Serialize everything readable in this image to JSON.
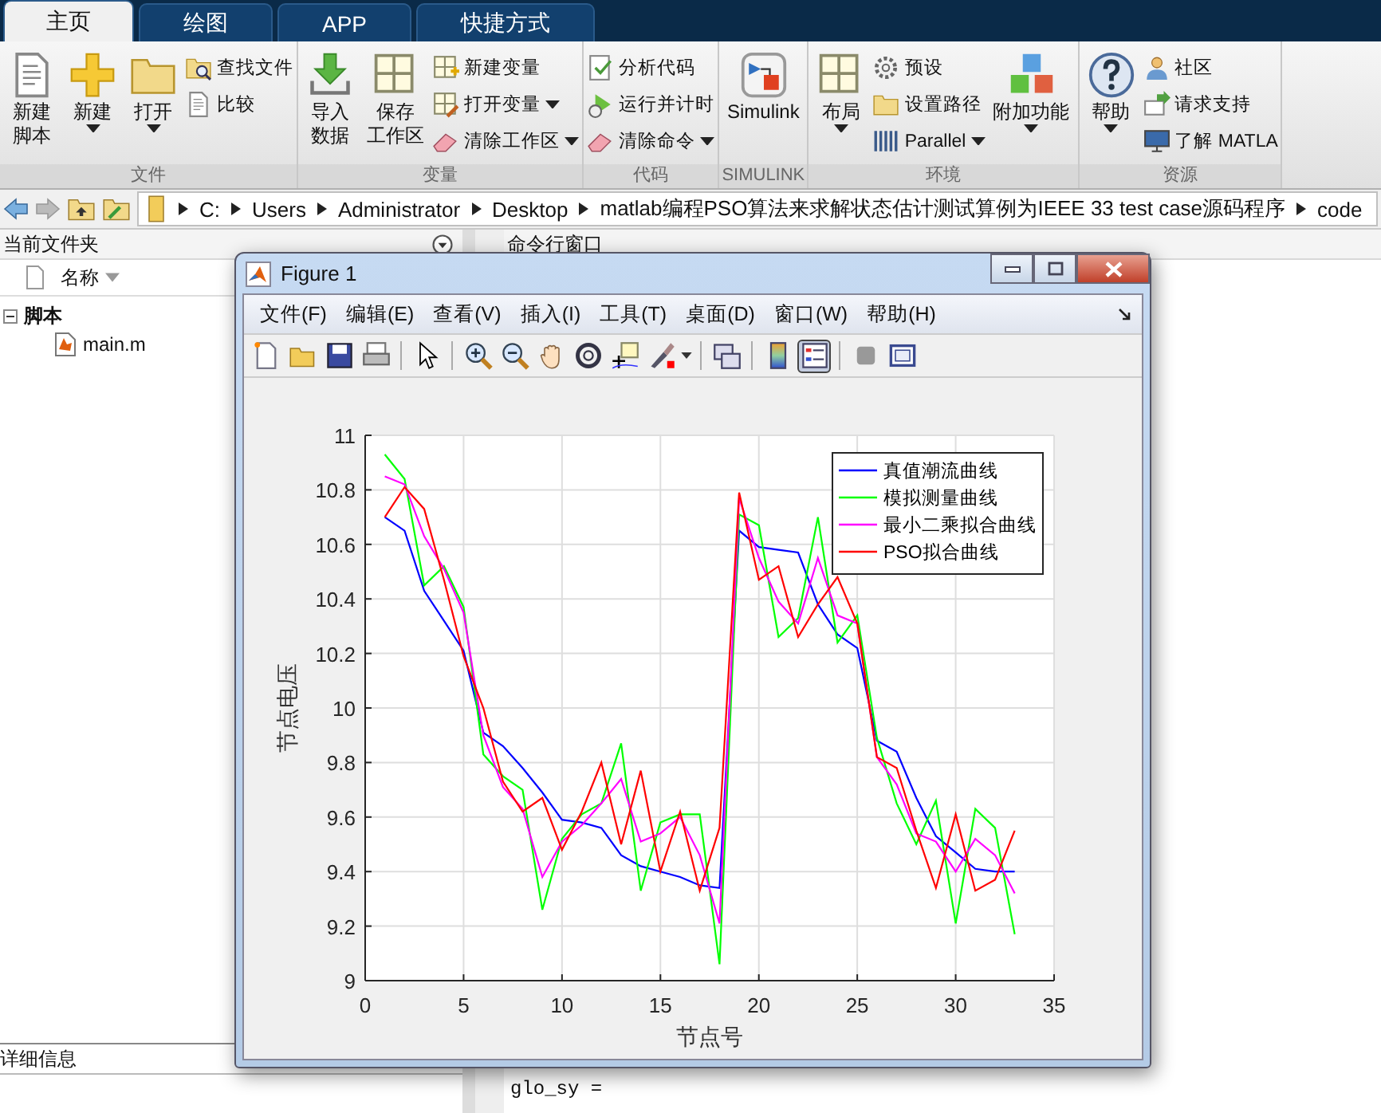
{
  "toolstrip": {
    "tabs": [
      {
        "label": "主页",
        "selected": true
      },
      {
        "label": "绘图",
        "selected": false
      },
      {
        "label": "APP",
        "selected": false
      },
      {
        "label": "快捷方式",
        "selected": false
      }
    ],
    "groups": [
      {
        "title": "文件",
        "items": [
          {
            "kind": "large",
            "lines": [
              "新建",
              "脚本"
            ],
            "dropdown": false
          },
          {
            "kind": "large",
            "lines": [
              "新建"
            ],
            "dropdown": true
          },
          {
            "kind": "large",
            "lines": [
              "打开"
            ],
            "dropdown": true
          },
          {
            "kind": "column",
            "items": [
              {
                "label": "查找文件",
                "dropdown": false
              },
              {
                "label": "比较",
                "dropdown": false
              }
            ]
          }
        ]
      },
      {
        "title": "变量",
        "items": [
          {
            "kind": "large",
            "lines": [
              "导入",
              "数据"
            ],
            "dropdown": false
          },
          {
            "kind": "large",
            "lines": [
              "保存",
              "工作区"
            ],
            "dropdown": false
          },
          {
            "kind": "column",
            "items": [
              {
                "label": "新建变量",
                "dropdown": false
              },
              {
                "label": "打开变量",
                "dropdown": true
              },
              {
                "label": "清除工作区",
                "dropdown": true
              }
            ]
          }
        ]
      },
      {
        "title": "代码",
        "items": [
          {
            "kind": "column",
            "items": [
              {
                "label": "分析代码",
                "dropdown": false
              },
              {
                "label": "运行并计时",
                "dropdown": false
              },
              {
                "label": "清除命令",
                "dropdown": true
              }
            ]
          }
        ]
      },
      {
        "title": "SIMULINK",
        "items": [
          {
            "kind": "large",
            "lines": [
              "Simulink"
            ],
            "dropdown": false
          }
        ]
      },
      {
        "title": "环境",
        "items": [
          {
            "kind": "large",
            "lines": [
              "布局"
            ],
            "dropdown": true
          },
          {
            "kind": "column",
            "items": [
              {
                "label": "预设",
                "dropdown": false
              },
              {
                "label": "设置路径",
                "dropdown": false
              },
              {
                "label": "Parallel",
                "dropdown": true
              }
            ]
          },
          {
            "kind": "large",
            "lines": [
              "附加功能"
            ],
            "dropdown": true
          }
        ]
      },
      {
        "title": "资源",
        "items": [
          {
            "kind": "large",
            "lines": [
              "帮助"
            ],
            "dropdown": true
          },
          {
            "kind": "column",
            "items": [
              {
                "label": "社区",
                "dropdown": false
              },
              {
                "label": "请求支持",
                "dropdown": false
              },
              {
                "label": "了解 MATLA",
                "dropdown": false
              }
            ]
          }
        ]
      }
    ]
  },
  "address_bar": {
    "path": [
      "C:",
      "Users",
      "Administrator",
      "Desktop",
      "matlab编程PSO算法来求解状态估计测试算例为IEEE 33 test case源码程序",
      "code"
    ]
  },
  "current_folder": {
    "title": "当前文件夹",
    "column": "名称",
    "tree": [
      {
        "label": "脚本",
        "expanded": true,
        "children": [
          {
            "label": "main.m"
          }
        ]
      }
    ],
    "details_title": "详细信息"
  },
  "command_window": {
    "title": "命令行窗口",
    "lines": [
      "glo_sy ="
    ]
  },
  "figure": {
    "title": "Figure 1",
    "menu": [
      "文件(F)",
      "编辑(E)",
      "查看(V)",
      "插入(I)",
      "工具(T)",
      "桌面(D)",
      "窗口(W)",
      "帮助(H)"
    ],
    "toolbar": [
      {
        "kind": "new",
        "pressed": false
      },
      {
        "kind": "open",
        "pressed": false
      },
      {
        "kind": "save",
        "pressed": false
      },
      {
        "kind": "print",
        "pressed": false
      },
      {
        "kind": "separator"
      },
      {
        "kind": "pointer",
        "pressed": false
      },
      {
        "kind": "separator"
      },
      {
        "kind": "zoom-in",
        "pressed": false
      },
      {
        "kind": "zoom-out",
        "pressed": false
      },
      {
        "kind": "pan",
        "pressed": false
      },
      {
        "kind": "rotate",
        "pressed": false
      },
      {
        "kind": "data-cursor",
        "pressed": false
      },
      {
        "kind": "brush",
        "pressed": false
      },
      {
        "kind": "caret"
      },
      {
        "kind": "separator"
      },
      {
        "kind": "link",
        "pressed": false
      },
      {
        "kind": "separator"
      },
      {
        "kind": "colorbar",
        "pressed": false
      },
      {
        "kind": "legend",
        "pressed": true
      },
      {
        "kind": "separator"
      },
      {
        "kind": "hide",
        "pressed": false
      },
      {
        "kind": "dock",
        "pressed": false
      }
    ],
    "chart_data": {
      "type": "line",
      "xlabel": "节点号",
      "ylabel": "节点电压",
      "x": [
        1,
        2,
        3,
        4,
        5,
        6,
        7,
        8,
        9,
        10,
        11,
        12,
        13,
        14,
        15,
        16,
        17,
        18,
        19,
        20,
        21,
        22,
        23,
        24,
        25,
        26,
        27,
        28,
        29,
        30,
        31,
        32,
        33
      ],
      "series": [
        {
          "name": "真值潮流曲线",
          "color": "#0000ff",
          "values": [
            10.7,
            10.65,
            10.43,
            10.32,
            10.21,
            9.91,
            9.86,
            9.78,
            9.69,
            9.59,
            9.58,
            9.56,
            9.46,
            9.42,
            9.4,
            9.38,
            9.35,
            9.34,
            10.65,
            10.59,
            10.58,
            10.57,
            10.38,
            10.27,
            10.22,
            9.88,
            9.84,
            9.67,
            9.53,
            9.47,
            9.41,
            9.4,
            9.4
          ]
        },
        {
          "name": "模拟测量曲线",
          "color": "#00ff00",
          "values": [
            10.93,
            10.84,
            10.45,
            10.52,
            10.37,
            9.83,
            9.75,
            9.7,
            9.26,
            9.52,
            9.61,
            9.65,
            9.87,
            9.33,
            9.58,
            9.61,
            9.61,
            9.06,
            10.71,
            10.67,
            10.26,
            10.33,
            10.7,
            10.24,
            10.34,
            9.89,
            9.65,
            9.5,
            9.66,
            9.21,
            9.63,
            9.56,
            9.17
          ]
        },
        {
          "name": "最小二乘拟合曲线",
          "color": "#ff00ff",
          "values": [
            10.85,
            10.82,
            10.63,
            10.51,
            10.35,
            9.9,
            9.71,
            9.63,
            9.38,
            9.51,
            9.57,
            9.65,
            9.74,
            9.51,
            9.54,
            9.6,
            9.46,
            9.21,
            10.77,
            10.55,
            10.39,
            10.31,
            10.55,
            10.34,
            10.31,
            9.82,
            9.72,
            9.54,
            9.51,
            9.4,
            9.52,
            9.46,
            9.32
          ]
        },
        {
          "name": "PSO拟合曲线",
          "color": "#ff0000",
          "values": [
            10.7,
            10.81,
            10.73,
            10.47,
            10.19,
            10.0,
            9.73,
            9.62,
            9.67,
            9.48,
            9.62,
            9.8,
            9.5,
            9.77,
            9.4,
            9.62,
            9.33,
            9.56,
            10.79,
            10.47,
            10.52,
            10.26,
            10.38,
            10.48,
            10.31,
            9.82,
            9.78,
            9.55,
            9.34,
            9.61,
            9.33,
            9.37,
            9.55
          ]
        }
      ],
      "grid": true,
      "legend": true,
      "xlim": [
        0,
        35
      ],
      "ylim": [
        9,
        11
      ],
      "xticks": [
        0,
        5,
        10,
        15,
        20,
        25,
        30,
        35
      ],
      "yticks": [
        9,
        9.2,
        9.4,
        9.6,
        9.8,
        10,
        10.2,
        10.4,
        10.6,
        10.8,
        11
      ]
    }
  }
}
